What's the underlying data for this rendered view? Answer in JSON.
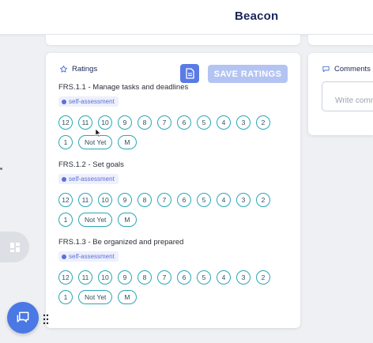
{
  "header": {
    "brand": "Beacon"
  },
  "ratings_panel": {
    "title": "Ratings",
    "save_label": "SAVE RATINGS",
    "items": [
      {
        "title": "FRS.1.1 - Manage tasks and deadlines",
        "tag": "self-assessment",
        "options": [
          "12",
          "11",
          "10",
          "9",
          "8",
          "7",
          "6",
          "5",
          "4",
          "3",
          "2",
          "1",
          "Not Yet",
          "M"
        ]
      },
      {
        "title": "FRS.1.2 - Set goals",
        "tag": "self-assessment",
        "options": [
          "12",
          "11",
          "10",
          "9",
          "8",
          "7",
          "6",
          "5",
          "4",
          "3",
          "2",
          "1",
          "Not Yet",
          "M"
        ]
      },
      {
        "title": "FRS.1.3 - Be organized and prepared",
        "tag": "self-assessment",
        "options": [
          "12",
          "11",
          "10",
          "9",
          "8",
          "7",
          "6",
          "5",
          "4",
          "3",
          "2",
          "1",
          "Not Yet",
          "M"
        ]
      }
    ]
  },
  "comments_panel": {
    "title": "Comments",
    "placeholder": "Write comments"
  },
  "icons": {
    "ratings": "star-icon",
    "comments": "chat-bubble-icon",
    "doc": "document-icon",
    "sidebar": "dashboard-grid-icon",
    "fab": "chat-icon",
    "drag": "drag-handle-icon"
  },
  "colors": {
    "brand_text": "#1b2559",
    "accent": "#5a7be6",
    "chip_border": "#2ba7b3",
    "save_disabled": "#b4c4f2"
  }
}
